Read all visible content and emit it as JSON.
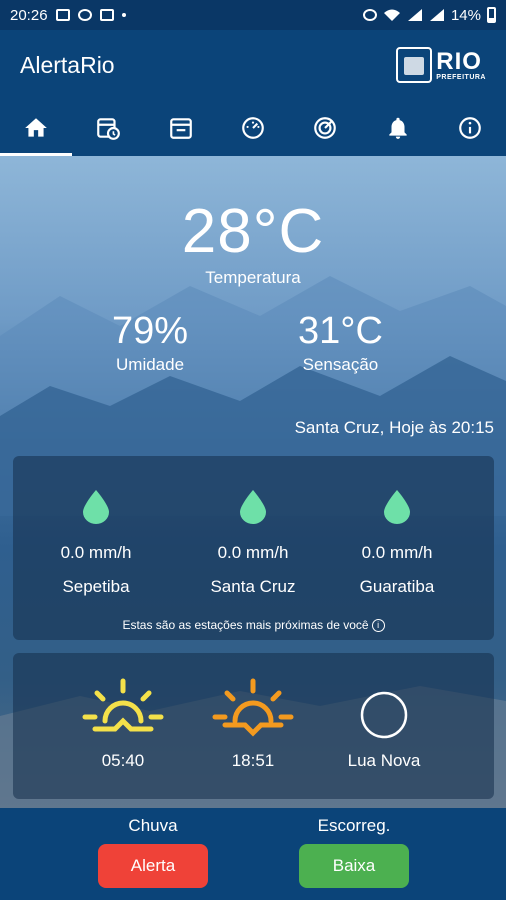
{
  "status_bar": {
    "time": "20:26",
    "battery": "14%"
  },
  "app": {
    "title": "AlertaRio"
  },
  "logo": {
    "big": "RIO",
    "small": "PREFEITURA"
  },
  "tabs": [
    {
      "icon": "home-icon",
      "active": true
    },
    {
      "icon": "calendar-clock-icon"
    },
    {
      "icon": "calendar-icon"
    },
    {
      "icon": "gauge-icon"
    },
    {
      "icon": "radar-icon"
    },
    {
      "icon": "bell-icon"
    },
    {
      "icon": "info-icon"
    }
  ],
  "weather": {
    "temperature": "28°C",
    "temperature_label": "Temperatura",
    "humidity": "79%",
    "humidity_label": "Umidade",
    "feels_like": "31°C",
    "feels_like_label": "Sensação",
    "station_time": "Santa Cruz, Hoje às 20:15"
  },
  "rain": {
    "stations": [
      {
        "value": "0.0 mm/h",
        "name": "Sepetiba"
      },
      {
        "value": "0.0 mm/h",
        "name": "Santa Cruz"
      },
      {
        "value": "0.0 mm/h",
        "name": "Guaratiba"
      }
    ],
    "note": "Estas são as estações mais próximas de você",
    "drop_color": "#6ee0a8"
  },
  "sun": {
    "sunrise": "05:40",
    "sunset": "18:51",
    "moon": "Lua Nova",
    "sunrise_color": "#f4e14a",
    "sunset_color": "#f39a1f"
  },
  "bottom": {
    "rain_label": "Chuva",
    "rain_button": "Alerta",
    "rain_color": "#ef4238",
    "slide_label": "Escorreg.",
    "slide_button": "Baixa",
    "slide_color": "#4cb050"
  }
}
